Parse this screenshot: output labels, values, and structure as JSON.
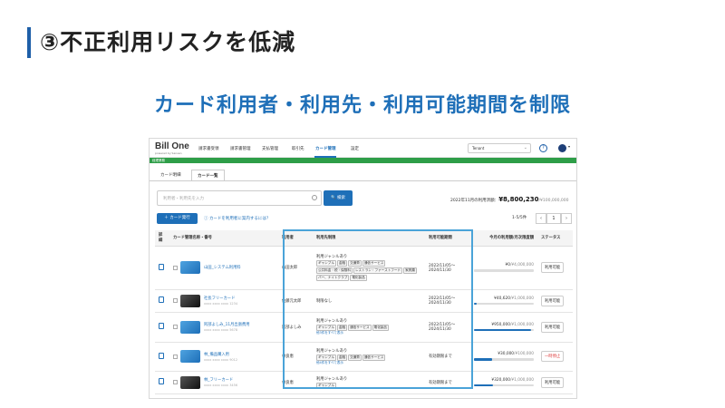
{
  "slide": {
    "title": "③不正利用リスクを低減",
    "subtitle": "カード利用者・利用先・利用可能期間を制限"
  },
  "app": {
    "logo": "Bill One",
    "logo_sub": "powered by Sansan",
    "nav": [
      "請求書受領",
      "請求書管理",
      "支払管理",
      "取引先",
      "カード管理",
      "設定"
    ],
    "active_nav": "カード管理",
    "tenant": "Tenant",
    "section_label": "経理業務"
  },
  "tabs": [
    "カード明細",
    "カード一覧"
  ],
  "search": {
    "placeholder": "利用者・利用先を入力",
    "button": "検索"
  },
  "usage": {
    "label": "2022年11月の利用済額：",
    "amount": "¥8,800,230",
    "limit": "/¥100,000,000"
  },
  "issue_button": "＋ カード発行",
  "howto_link": "カードを利用者に案内するには？",
  "pager": {
    "range": "1-5/5件",
    "page": "1"
  },
  "columns": [
    "詳細",
    "カード管理名称・番号",
    "利用者",
    "利用先制限",
    "利用可能期間",
    "今月の利用額/月次限度額",
    "ステータス"
  ],
  "rows": [
    {
      "card_style": "blue",
      "name": "山田_システム利用料",
      "number": "",
      "user": "山田太郎",
      "restriction_title": "利用ジャンルあり",
      "tags": [
        "ギャンブル",
        "金融",
        "交通費",
        "通信サービス",
        "公共料金・税・保険料",
        "レストラン・ファーストフード",
        "家具類",
        "バー、ナイトクラブ",
        "電化製品"
      ],
      "more": "",
      "period": "2022/11/05〜\n2024/11/30",
      "usage": "¥0",
      "limit": "/¥4,000,000",
      "ratio": 0,
      "status": "利用可能",
      "stopped": false
    },
    {
      "card_style": "black",
      "name": "社長フリーカード",
      "number": "xxxx xxxx xxxx 1234",
      "user": "佐藤元太郎",
      "restriction_title": "制限なし",
      "tags": [],
      "more": "",
      "period": "2022/11/05〜\n2024/11/30",
      "usage": "¥40,620",
      "limit": "/¥1,000,000",
      "ratio": 0.04,
      "status": "利用可能",
      "stopped": false
    },
    {
      "card_style": "blue",
      "name": "阿部よしみ_11月出張费用",
      "number": "xxxx xxxx xxxx 5678",
      "user": "阿部よしみ",
      "restriction_title": "利用ジャンルあり",
      "tags": [
        "ギャンブル",
        "金融",
        "通信サービス",
        "電化製品"
      ],
      "more": "他3件をすべて表示",
      "period": "2022/11/05〜\n2024/11/30",
      "usage": "¥950,000",
      "limit": "/¥1,000,000",
      "ratio": 0.95,
      "status": "利用可能",
      "stopped": false
    },
    {
      "card_style": "blue",
      "name": "林_備品購入用",
      "number": "xxxx xxxx xxxx 9012",
      "user": "林良恵",
      "restriction_title": "利用ジャンルあり",
      "tags": [
        "ギャンブル",
        "金融",
        "交通費",
        "通信サービス"
      ],
      "more": "他4件をすべて表示",
      "period": "有効期限まで",
      "usage": "¥30,000",
      "limit": "/¥100,000",
      "ratio": 0.3,
      "status": "一時停止",
      "stopped": true
    },
    {
      "card_style": "black",
      "name": "林_フリーカード",
      "number": "xxxx xxxx xxxx 3456",
      "user": "林良恵",
      "restriction_title": "利用ジャンルあり",
      "tags": [
        "ギャンブル"
      ],
      "more": "",
      "period": "有効期限まで",
      "usage": "¥320,000",
      "limit": "/¥1,000,000",
      "ratio": 0.32,
      "status": "利用可能",
      "stopped": false
    }
  ],
  "colors": {
    "accent": "#1e6fb8",
    "highlight": "#4aa3d8",
    "green": "#2e9e48",
    "stop": "#d33"
  }
}
